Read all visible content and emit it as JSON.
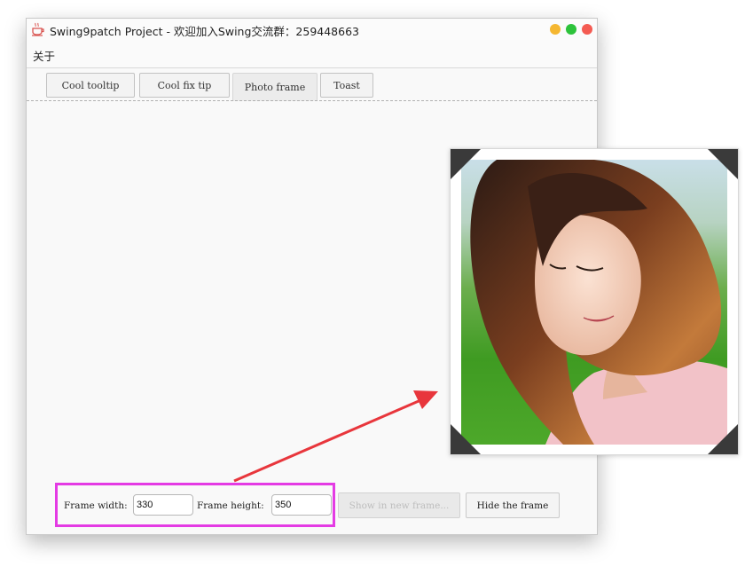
{
  "window": {
    "title": "Swing9patch Project - 欢迎加入Swing交流群：259448663",
    "icon": "coffee-cup-icon"
  },
  "menu": {
    "items": [
      "关于"
    ]
  },
  "tabs": [
    {
      "label": "Cool tooltip",
      "active": false
    },
    {
      "label": "Cool fix tip",
      "active": false
    },
    {
      "label": "Photo frame",
      "active": true
    },
    {
      "label": "Toast",
      "active": false
    }
  ],
  "controls": {
    "width_label": "Frame width:",
    "width_value": "330",
    "height_label": "Frame height:",
    "height_value": "350",
    "show_button": "Show in new frame...",
    "hide_button": "Hide the frame"
  },
  "colors": {
    "highlight": "#e43be4",
    "arrow": "#e8363c",
    "minimize": "#f5b731",
    "maximize": "#2dc33b",
    "close": "#f45b52"
  }
}
